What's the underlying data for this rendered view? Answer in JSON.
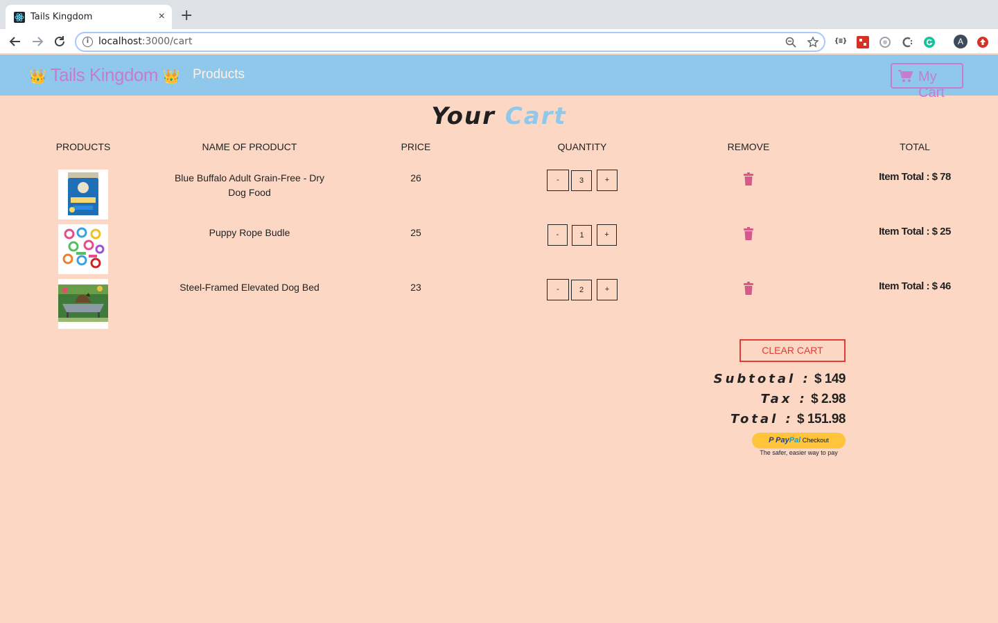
{
  "browser": {
    "tab_title": "Tails Kingdom",
    "tab_close": "×",
    "new_tab": "+",
    "url_host": "localhost",
    "url_rest": ":3000/cart",
    "info_glyph": "i",
    "omnibox_icons": [
      "zoom-icon",
      "star-icon"
    ],
    "extensions": [
      "json-viewer-icon",
      "extension-red-icon",
      "extension-circle-icon",
      "extension-c-icon",
      "grammarly-icon",
      "profile-avatar",
      "update-icon"
    ],
    "json_ext_label": "{≡}",
    "profile_letter": "A"
  },
  "nav": {
    "brand": "Tails Kingdom",
    "brand_crown": "👑",
    "products_link": "Products",
    "cart_button": "My Cart"
  },
  "page": {
    "title_word1": "Your",
    "title_word2": "Cart"
  },
  "table": {
    "headers": [
      "PRODUCTS",
      "NAME OF PRODUCT",
      "PRICE",
      "QUANTITY",
      "REMOVE",
      "TOTAL"
    ],
    "minus_label": "-",
    "plus_label": "+",
    "rows": [
      {
        "name": "Blue Buffalo Adult Grain-Free - Dry Dog Food",
        "price": "26",
        "qty": "3",
        "total": "Item Total : $ 78",
        "image": "dog-food-bag"
      },
      {
        "name": "Puppy Rope Budle",
        "price": "25",
        "qty": "1",
        "total": "Item Total : $ 25",
        "image": "rope-toys"
      },
      {
        "name": "Steel-Framed Elevated Dog Bed",
        "price": "23",
        "qty": "2",
        "total": "Item Total : $ 46",
        "image": "dog-bed"
      }
    ]
  },
  "summary": {
    "clear_cart": "CLEAR CART",
    "subtotal_label": "Subtotal :",
    "subtotal_value": "$ 149",
    "tax_label": "Tax :",
    "tax_value": "$ 2.98",
    "total_label": "Total :",
    "total_value": "$ 151.98",
    "paypal_p": "P",
    "paypal_word1": "Pay",
    "paypal_word2": "Pal",
    "paypal_checkout": "Checkout",
    "paypal_tagline": "The safer, easier way to pay"
  },
  "colors": {
    "page_bg": "#fcd7c4",
    "nav_bg": "#90c8ec",
    "brand": "#c77bd0",
    "accent_red": "#e53935",
    "trash": "#d45a8a",
    "paypal_yellow": "#ffc439"
  }
}
